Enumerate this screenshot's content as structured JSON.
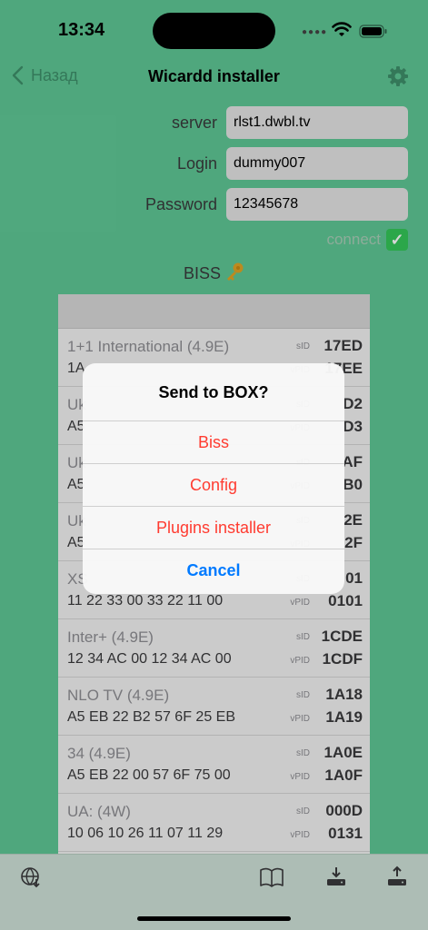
{
  "status_bar": {
    "time": "13:34"
  },
  "nav": {
    "back_label": "Назад",
    "title": "Wicardd installer"
  },
  "form": {
    "server_label": "server",
    "server_value": "rlst1.dwbl.tv",
    "login_label": "Login",
    "login_value": "dummy007",
    "password_label": "Password",
    "password_value": "12345678"
  },
  "connect": {
    "label": "connect"
  },
  "biss": {
    "title": "BISS"
  },
  "list": {
    "sid_label": "sID",
    "vpid_label": "vPID",
    "channels": [
      {
        "name": "1+1 International (4.9E)",
        "key": "1A",
        "sid": "17ED",
        "vpid": "17EE"
      },
      {
        "name": "Uk",
        "key": "A5",
        "sid": "D2",
        "vpid": "D3"
      },
      {
        "name": "Uk",
        "key": "A5",
        "sid": "AF",
        "vpid": "B0"
      },
      {
        "name": "Uk",
        "key": "A5",
        "sid": "2E",
        "vpid": "2F"
      },
      {
        "name": "XS",
        "key": "11 22 33 00 33 22 11 00",
        "sid": "01",
        "vpid": "0101"
      },
      {
        "name": "Inter+ (4.9E)",
        "key": "12 34 AC 00 12 34 AC 00",
        "sid": "1CDE",
        "vpid": "1CDF"
      },
      {
        "name": "NLO TV (4.9E)",
        "key": "A5 EB 22 B2 57 6F 25 EB",
        "sid": "1A18",
        "vpid": "1A19"
      },
      {
        "name": "34 (4.9E)",
        "key": "A5 EB 22 00 57 6F 75 00",
        "sid": "1A0E",
        "vpid": "1A0F"
      },
      {
        "name": "UA: (4W)",
        "key": "10 06 10 26 11 07 11 29",
        "sid": "000D",
        "vpid": "0131"
      }
    ]
  },
  "alert": {
    "title": "Send to BOX?",
    "buttons": [
      "Biss",
      "Config",
      "Plugins installer"
    ],
    "cancel": "Cancel"
  },
  "tab_bar": {
    "icons": [
      "globe-download-icon",
      "book-icon",
      "download-icon",
      "upload-icon"
    ]
  },
  "colors": {
    "background": "#5fc896",
    "destructive": "#ff3b30",
    "accent": "#007aff"
  }
}
